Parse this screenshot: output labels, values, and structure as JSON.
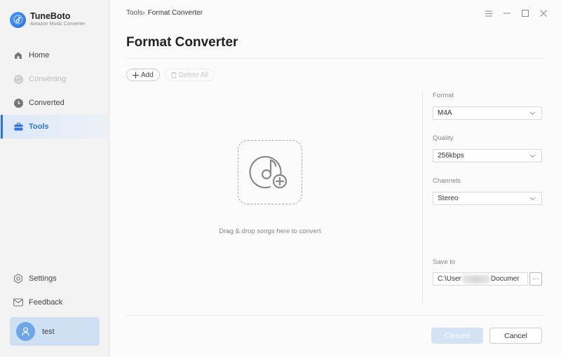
{
  "app": {
    "name": "TuneBoto",
    "subtitle": "Amazon Music Converter",
    "accent_color": "#2f73d9"
  },
  "sidebar": {
    "items": [
      {
        "label": "Home",
        "icon": "home-icon",
        "state": "normal"
      },
      {
        "label": "Converting",
        "icon": "sync-icon",
        "state": "disabled"
      },
      {
        "label": "Converted",
        "icon": "clock-icon",
        "state": "normal"
      },
      {
        "label": "Tools",
        "icon": "toolbox-icon",
        "state": "active"
      }
    ],
    "bottom_items": [
      {
        "label": "Settings",
        "icon": "gear-icon"
      },
      {
        "label": "Feedback",
        "icon": "mail-icon"
      }
    ],
    "user": {
      "name": "test",
      "icon": "user-icon"
    }
  },
  "header": {
    "breadcrumb_parent": "Tools",
    "breadcrumb_separator": "›",
    "breadcrumb_current": "Format Converter",
    "window_controls": [
      "menu-icon",
      "minimize-icon",
      "maximize-icon",
      "close-icon"
    ]
  },
  "main": {
    "title": "Format Converter",
    "toolbar": {
      "add_label": "Add",
      "delete_all_label": "Delete All"
    },
    "dropzone": {
      "icon": "music-add-icon",
      "text": "Drag & drop songs here to convert"
    }
  },
  "settings": {
    "format": {
      "label": "Format",
      "value": "M4A"
    },
    "quality": {
      "label": "Quality",
      "value": "256kbps"
    },
    "channels": {
      "label": "Channels",
      "value": "Stereo"
    },
    "save_to": {
      "label": "Save to",
      "value_start": "C:\\User",
      "value_end": "Documer",
      "browse_label": "···"
    }
  },
  "footer": {
    "convert_label": "Convert",
    "cancel_label": "Cancel"
  }
}
